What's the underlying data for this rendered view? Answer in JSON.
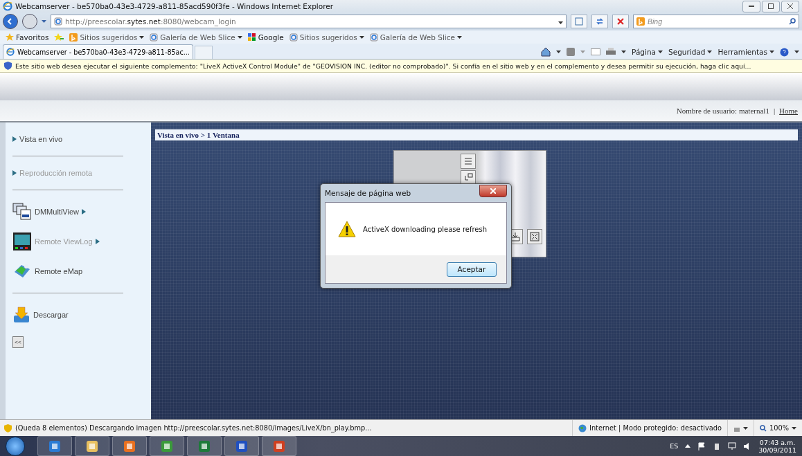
{
  "window": {
    "title": "Webcamserver - be570ba0-43e3-4729-a811-85acd590f3fe - Windows Internet Explorer"
  },
  "address_bar": {
    "url_prefix": "http://preescolar.",
    "url_domain": "sytes.net",
    "url_rest": ":8080/webcam_login",
    "search_placeholder": "Bing"
  },
  "favorites_bar": {
    "label": "Favoritos",
    "links": [
      {
        "label": "Sitios sugeridos",
        "dropdown": true,
        "kind": "sites"
      },
      {
        "label": "Galería de Web Slice",
        "dropdown": true,
        "kind": "page"
      },
      {
        "label": "Google",
        "dropdown": false,
        "kind": "google"
      },
      {
        "label": "Sitios sugeridos",
        "dropdown": true,
        "kind": "page"
      },
      {
        "label": "Galería de Web Slice",
        "dropdown": true,
        "kind": "page"
      }
    ]
  },
  "tabs": [
    {
      "label": "Webcamserver - be570ba0-43e3-4729-a811-85ac...",
      "selected": true
    }
  ],
  "command_bar": [
    "Página",
    "Seguridad",
    "Herramientas"
  ],
  "info_bar": {
    "text": "Este sitio web desea ejecutar el siguiente complemento: \"LiveX ActiveX Control Module\" de \"GEOVISION INC. (editor no comprobado)\". Si confía en el sitio web y en el complemento y desea permitir su ejecución, haga clic aquí..."
  },
  "page_header": {
    "user_label": "Nombre de usuario: maternal1",
    "separator": "|",
    "home_link": "Home"
  },
  "sidebar": {
    "items": [
      {
        "label": "Vista en vivo",
        "kind": "arrow",
        "disabled": false,
        "divider": true
      },
      {
        "label": "Reproducción remota",
        "kind": "arrow",
        "disabled": true,
        "divider": true
      },
      {
        "label": "DMMultiView",
        "kind": "multiview",
        "disabled": false,
        "divider": false
      },
      {
        "label": "Remote ViewLog",
        "kind": "viewlog",
        "disabled": true,
        "divider": false
      },
      {
        "label": "Remote eMap",
        "kind": "emap",
        "disabled": false,
        "divider": true
      },
      {
        "label": "Descargar",
        "kind": "download",
        "disabled": false,
        "divider": false
      }
    ],
    "collapse_button": "<<"
  },
  "breadcrumb": "Vista en vivo > 1 Ventana",
  "dialog": {
    "title": "Mensaje de página web",
    "message": "ActiveX downloading please refresh",
    "button": "Aceptar"
  },
  "status_bar": {
    "message": "(Queda 8 elementos) Descargando imagen http://preescolar.sytes.net:8080/images/LiveX/bn_play.bmp...",
    "zone": "Internet | Modo protegido: desactivado",
    "zoom": "100%"
  },
  "taskbar": {
    "apps": [
      {
        "kind": "ie"
      },
      {
        "kind": "folder"
      },
      {
        "kind": "media"
      },
      {
        "kind": "messenger"
      },
      {
        "kind": "excel"
      },
      {
        "kind": "remote"
      },
      {
        "kind": "powerpoint"
      }
    ],
    "language": "ES",
    "time": "07:43 a.m.",
    "date": "30/09/2011"
  }
}
